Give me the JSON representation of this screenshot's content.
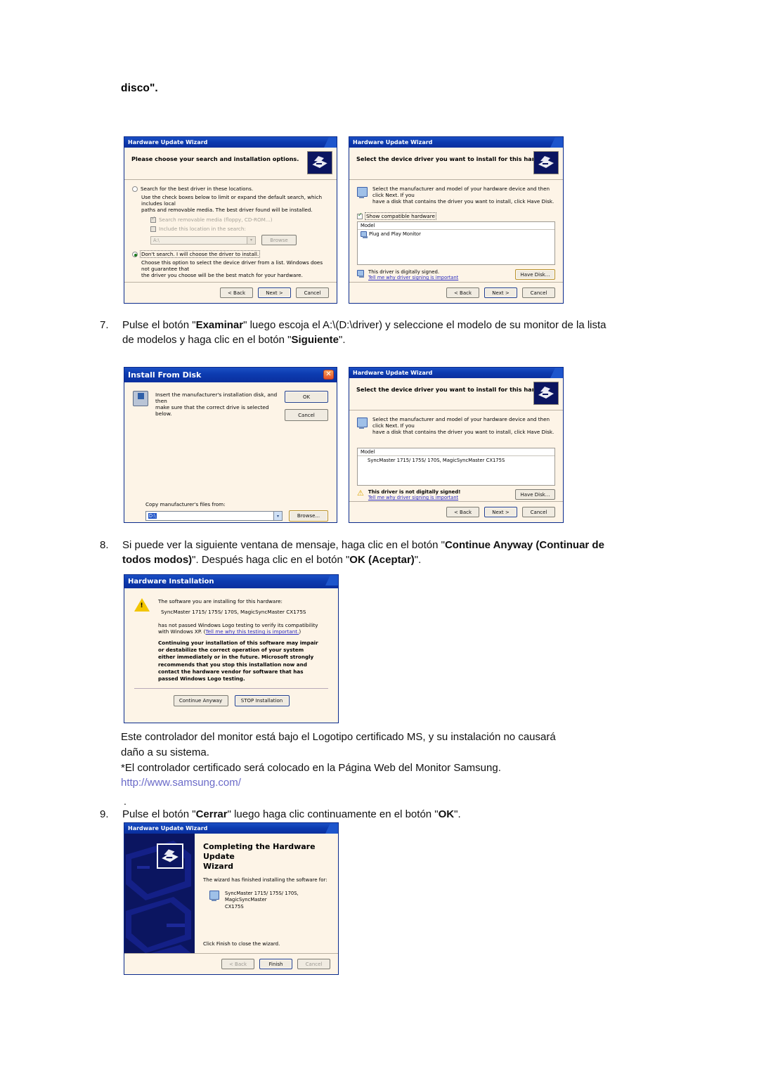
{
  "document": {
    "heading": "disco\".",
    "steps": [
      {
        "number": "7.",
        "text_html": "Pulse el botón \"Examinar\" luego escoja el A:\\(D:\\driver) y seleccione el modelo de su monitor de la lista de modelos y haga clic en el botón \"Siguiente\"."
      },
      {
        "number": "8.",
        "text_html": "Si puede ver la siguiente ventana de mensaje, haga clic en el botón \"Continue Anyway (Continuar de todos modos)\". Después haga clic en el botón \"OK (Aceptar)\"."
      },
      {
        "number": "9.",
        "text_html": "Pulse el botón \"Cerrar\" luego haga clic continuamente en el botón \"OK\"."
      }
    ],
    "paragraph": {
      "line1": "Este controlador del monitor está bajo el Logotipo certificado MS, y su instalación no causará",
      "line2": "daño a su sistema.",
      "line3": "*El controlador certificado será colocado en la Página Web del Monitor Samsung.",
      "url": "http://www.samsung.com/"
    },
    "stray_dot": "."
  },
  "dialog_search_options": {
    "title": "Hardware Update Wizard",
    "header": "Please choose your search and installation options.",
    "option_search": "Search for the best driver in these locations.",
    "option_search_desc_l1": "Use the check boxes below to limit or expand the default search, which includes local",
    "option_search_desc_l2": "paths and removable media. The best driver found will be installed.",
    "check_removable": "Search removable media (floppy, CD-ROM...)",
    "check_include": "Include this location in the search:",
    "location_value": "A:\\",
    "browse_label": "Browse",
    "option_dontsearch": "Don't search. I will choose the driver to install.",
    "option_dontsearch_desc_l1": "Choose this option to select the device driver from a list.  Windows does not guarantee that",
    "option_dontsearch_desc_l2": "the driver you choose will be the best match for your hardware.",
    "btn_back": "< Back",
    "btn_next": "Next >",
    "btn_cancel": "Cancel"
  },
  "dialog_select_driver_compatible": {
    "title": "Hardware Update Wizard",
    "header": "Select the device driver you want to install for this hardware.",
    "desc_l1": "Select the manufacturer and model of your hardware device and then click Next. If you",
    "desc_l2": "have a disk that contains the driver you want to install, click Have Disk.",
    "show_compatible": "Show compatible hardware",
    "column_model": "Model",
    "model_item": "Plug and Play Monitor",
    "signed_status": "This driver is digitally signed.",
    "signed_link": "Tell me why driver signing is important",
    "btn_have_disk": "Have Disk...",
    "btn_back": "< Back",
    "btn_next": "Next >",
    "btn_cancel": "Cancel"
  },
  "dialog_install_from_disk": {
    "title": "Install From Disk",
    "close_glyph": "✕",
    "msg_l1": "Insert the manufacturer's installation disk, and then",
    "msg_l2": "make sure that the correct drive is selected below.",
    "btn_ok": "OK",
    "btn_cancel": "Cancel",
    "copy_label": "Copy manufacturer's files from:",
    "path_value": "D:\\",
    "btn_browse": "Browse..."
  },
  "dialog_select_driver_samsung": {
    "title": "Hardware Update Wizard",
    "header": "Select the device driver you want to install for this hardware.",
    "desc_l1": "Select the manufacturer and model of your hardware device and then click Next. If you",
    "desc_l2": "have a disk that contains the driver you want to install, click Have Disk.",
    "column_model": "Model",
    "model_item": "SyncMaster 1715/ 175S/ 170S, MagicSyncMaster CX175S",
    "signed_status": "This driver is not digitally signed!",
    "signed_link": "Tell me why driver signing is important",
    "btn_have_disk": "Have Disk...",
    "btn_back": "< Back",
    "btn_next": "Next >",
    "btn_cancel": "Cancel"
  },
  "dialog_hardware_installation": {
    "title": "Hardware Installation",
    "line_intro": "The software you are installing for this hardware:",
    "line_device": "SyncMaster 1715/ 175S/ 170S, MagicSyncMaster CX175S",
    "line_warn_l1": "has not passed Windows Logo testing to verify its compatibility",
    "line_warn_l2_prefix": "with Windows XP. (",
    "line_warn_link": "Tell me why this testing is important.",
    "line_warn_l2_suffix": ")",
    "bold_l1": "Continuing your installation of this software may impair",
    "bold_l2": "or destabilize the correct operation of your system",
    "bold_l3": "either immediately or in the future. Microsoft strongly",
    "bold_l4": "recommends that you stop this installation now and",
    "bold_l5": "contact the hardware vendor for software that has",
    "bold_l6": "passed Windows Logo testing.",
    "btn_continue": "Continue Anyway",
    "btn_stop": "STOP Installation"
  },
  "dialog_completing": {
    "title": "Hardware Update Wizard",
    "heading_l1": "Completing the Hardware Update",
    "heading_l2": "Wizard",
    "subtext": "The wizard has finished installing the software for:",
    "device_l1": "SyncMaster 1715/ 175S/ 170S, MagicSyncMaster",
    "device_l2": "CX175S",
    "footer_text": "Click Finish to close the wizard.",
    "btn_back": "< Back",
    "btn_finish": "Finish",
    "btn_cancel": "Cancel"
  },
  "icons": {
    "wizard_glyph": "wizard-hand-disk-icon",
    "monitor_glyph": "monitor-icon",
    "warning_glyph": "warning-triangle-icon",
    "disk_glyph": "floppy-disk-icon",
    "close_glyph": "close-icon"
  },
  "colors": {
    "titlebar_blue": "#0c3bb0",
    "dialog_bg": "#fdf4e7",
    "link_blue": "#2b2bc0",
    "url_purple": "#6a6ac8",
    "selection_blue": "#1f54c8",
    "warning_yellow": "#f2c500",
    "wizard_navy": "#0b1560"
  }
}
